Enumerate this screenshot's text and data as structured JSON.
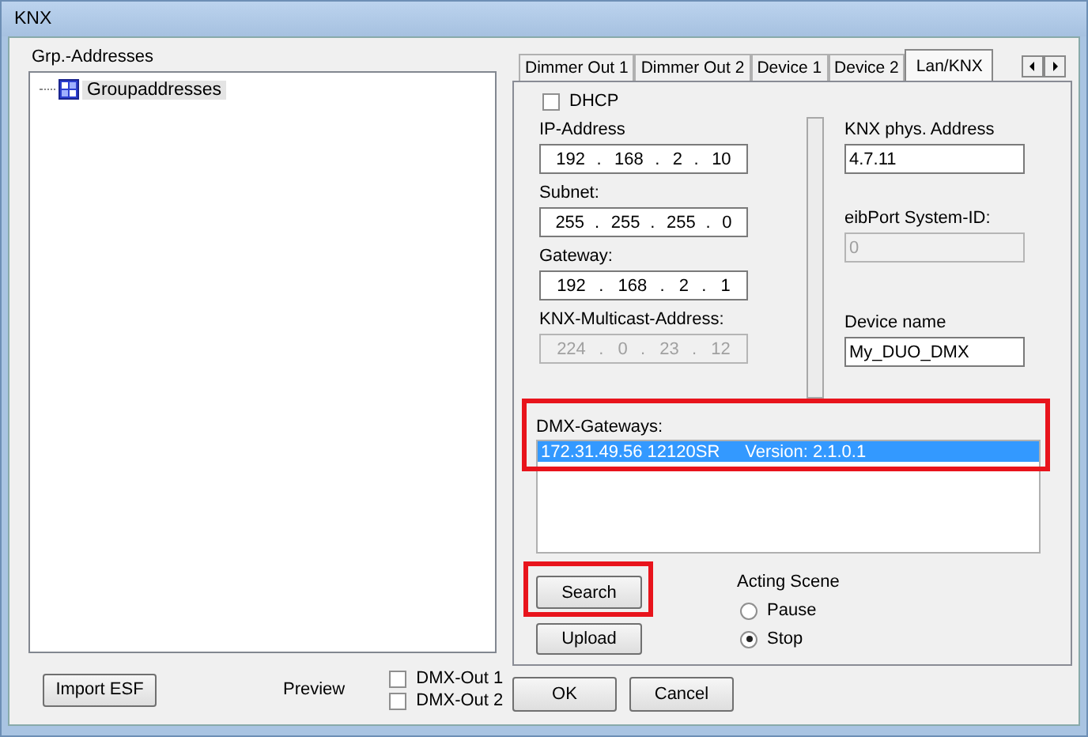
{
  "window": {
    "title": "KNX"
  },
  "group_panel": {
    "title": "Grp.-Addresses",
    "tree": [
      {
        "label": "Groupaddresses",
        "selected": true
      }
    ]
  },
  "tabs": [
    {
      "label": "Dimmer Out 1",
      "selected": false
    },
    {
      "label": "Dimmer Out 2",
      "selected": false
    },
    {
      "label": "Device 1",
      "selected": false
    },
    {
      "label": "Device 2",
      "selected": false
    },
    {
      "label": "Lan/KNX",
      "selected": true
    }
  ],
  "dhcp": {
    "label": "DHCP",
    "checked": false
  },
  "octet_separator": ".",
  "ip_fields": [
    {
      "label": "IP-Address",
      "octets": [
        "192",
        "168",
        "2",
        "10"
      ],
      "disabled": false
    },
    {
      "label": "Subnet:",
      "octets": [
        "255",
        "255",
        "255",
        "0"
      ],
      "disabled": false
    },
    {
      "label": "Gateway:",
      "octets": [
        "192",
        "168",
        "2",
        "1"
      ],
      "disabled": false
    },
    {
      "label": "KNX-Multicast-Address:",
      "octets": [
        "224",
        "0",
        "23",
        "12"
      ],
      "disabled": true
    }
  ],
  "right_fields": [
    {
      "label": "KNX phys. Address",
      "value": "4.7.11",
      "disabled": false
    },
    {
      "label": "eibPort System-ID:",
      "value": "0",
      "disabled": true
    },
    {
      "label": "Device name",
      "value": "My_DUO_DMX",
      "disabled": false
    }
  ],
  "dmx_gateways": {
    "label": "DMX-Gateways:",
    "highlighted": true,
    "items": [
      {
        "address": "172.31.49.56 12120SR",
        "version": "Version: 2.1.0.1",
        "selected": true
      }
    ]
  },
  "search_button": {
    "label": "Search",
    "highlighted": true
  },
  "upload_button": {
    "label": "Upload"
  },
  "acting_scene": {
    "label": "Acting Scene",
    "options": [
      {
        "label": "Pause",
        "selected": false
      },
      {
        "label": "Stop",
        "selected": true
      }
    ]
  },
  "import_button": "Import ESF",
  "preview": {
    "label": "Preview",
    "outputs": [
      {
        "label": "DMX-Out 1",
        "checked": false
      },
      {
        "label": "DMX-Out 2",
        "checked": false
      }
    ]
  },
  "dialog_buttons": [
    "OK",
    "Cancel"
  ]
}
